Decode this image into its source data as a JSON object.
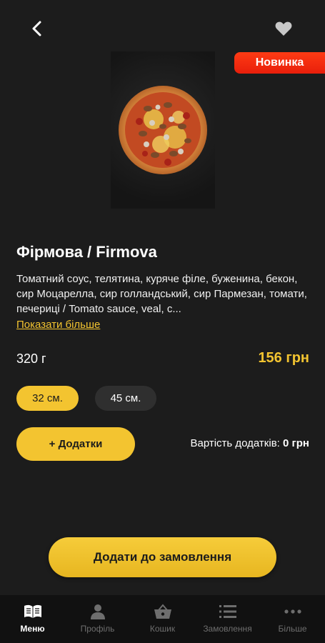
{
  "header": {
    "back_icon": "chevron-left-icon",
    "favorite_icon": "heart-icon"
  },
  "product": {
    "badge": "Новинка",
    "badge_color": "#f02a10",
    "title": "Фірмова / Firmova",
    "description": "Томатний соус, телятина, куряче філе, буженина, бекон, сир Моцарелла, сир голландський, сир Пармезан, томати, печериці / Tomato sauce, veal, c...",
    "show_more": "Показати більше",
    "weight": "320 г",
    "price": "156 грн",
    "sizes": [
      {
        "label": "32 см.",
        "selected": true
      },
      {
        "label": "45 см.",
        "selected": false
      }
    ]
  },
  "addons": {
    "button_label": "+ Додатки",
    "cost_label": "Вартість додатків:",
    "cost_value": "0 грн"
  },
  "order": {
    "button_label": "Додати до замовлення"
  },
  "accent_color": "#f3c430",
  "bottom_nav": [
    {
      "label": "Меню",
      "icon": "book-icon",
      "active": true
    },
    {
      "label": "Профіль",
      "icon": "person-icon",
      "active": false
    },
    {
      "label": "Кошик",
      "icon": "basket-icon",
      "active": false
    },
    {
      "label": "Замовлення",
      "icon": "list-icon",
      "active": false
    },
    {
      "label": "Більше",
      "icon": "more-icon",
      "active": false
    }
  ]
}
